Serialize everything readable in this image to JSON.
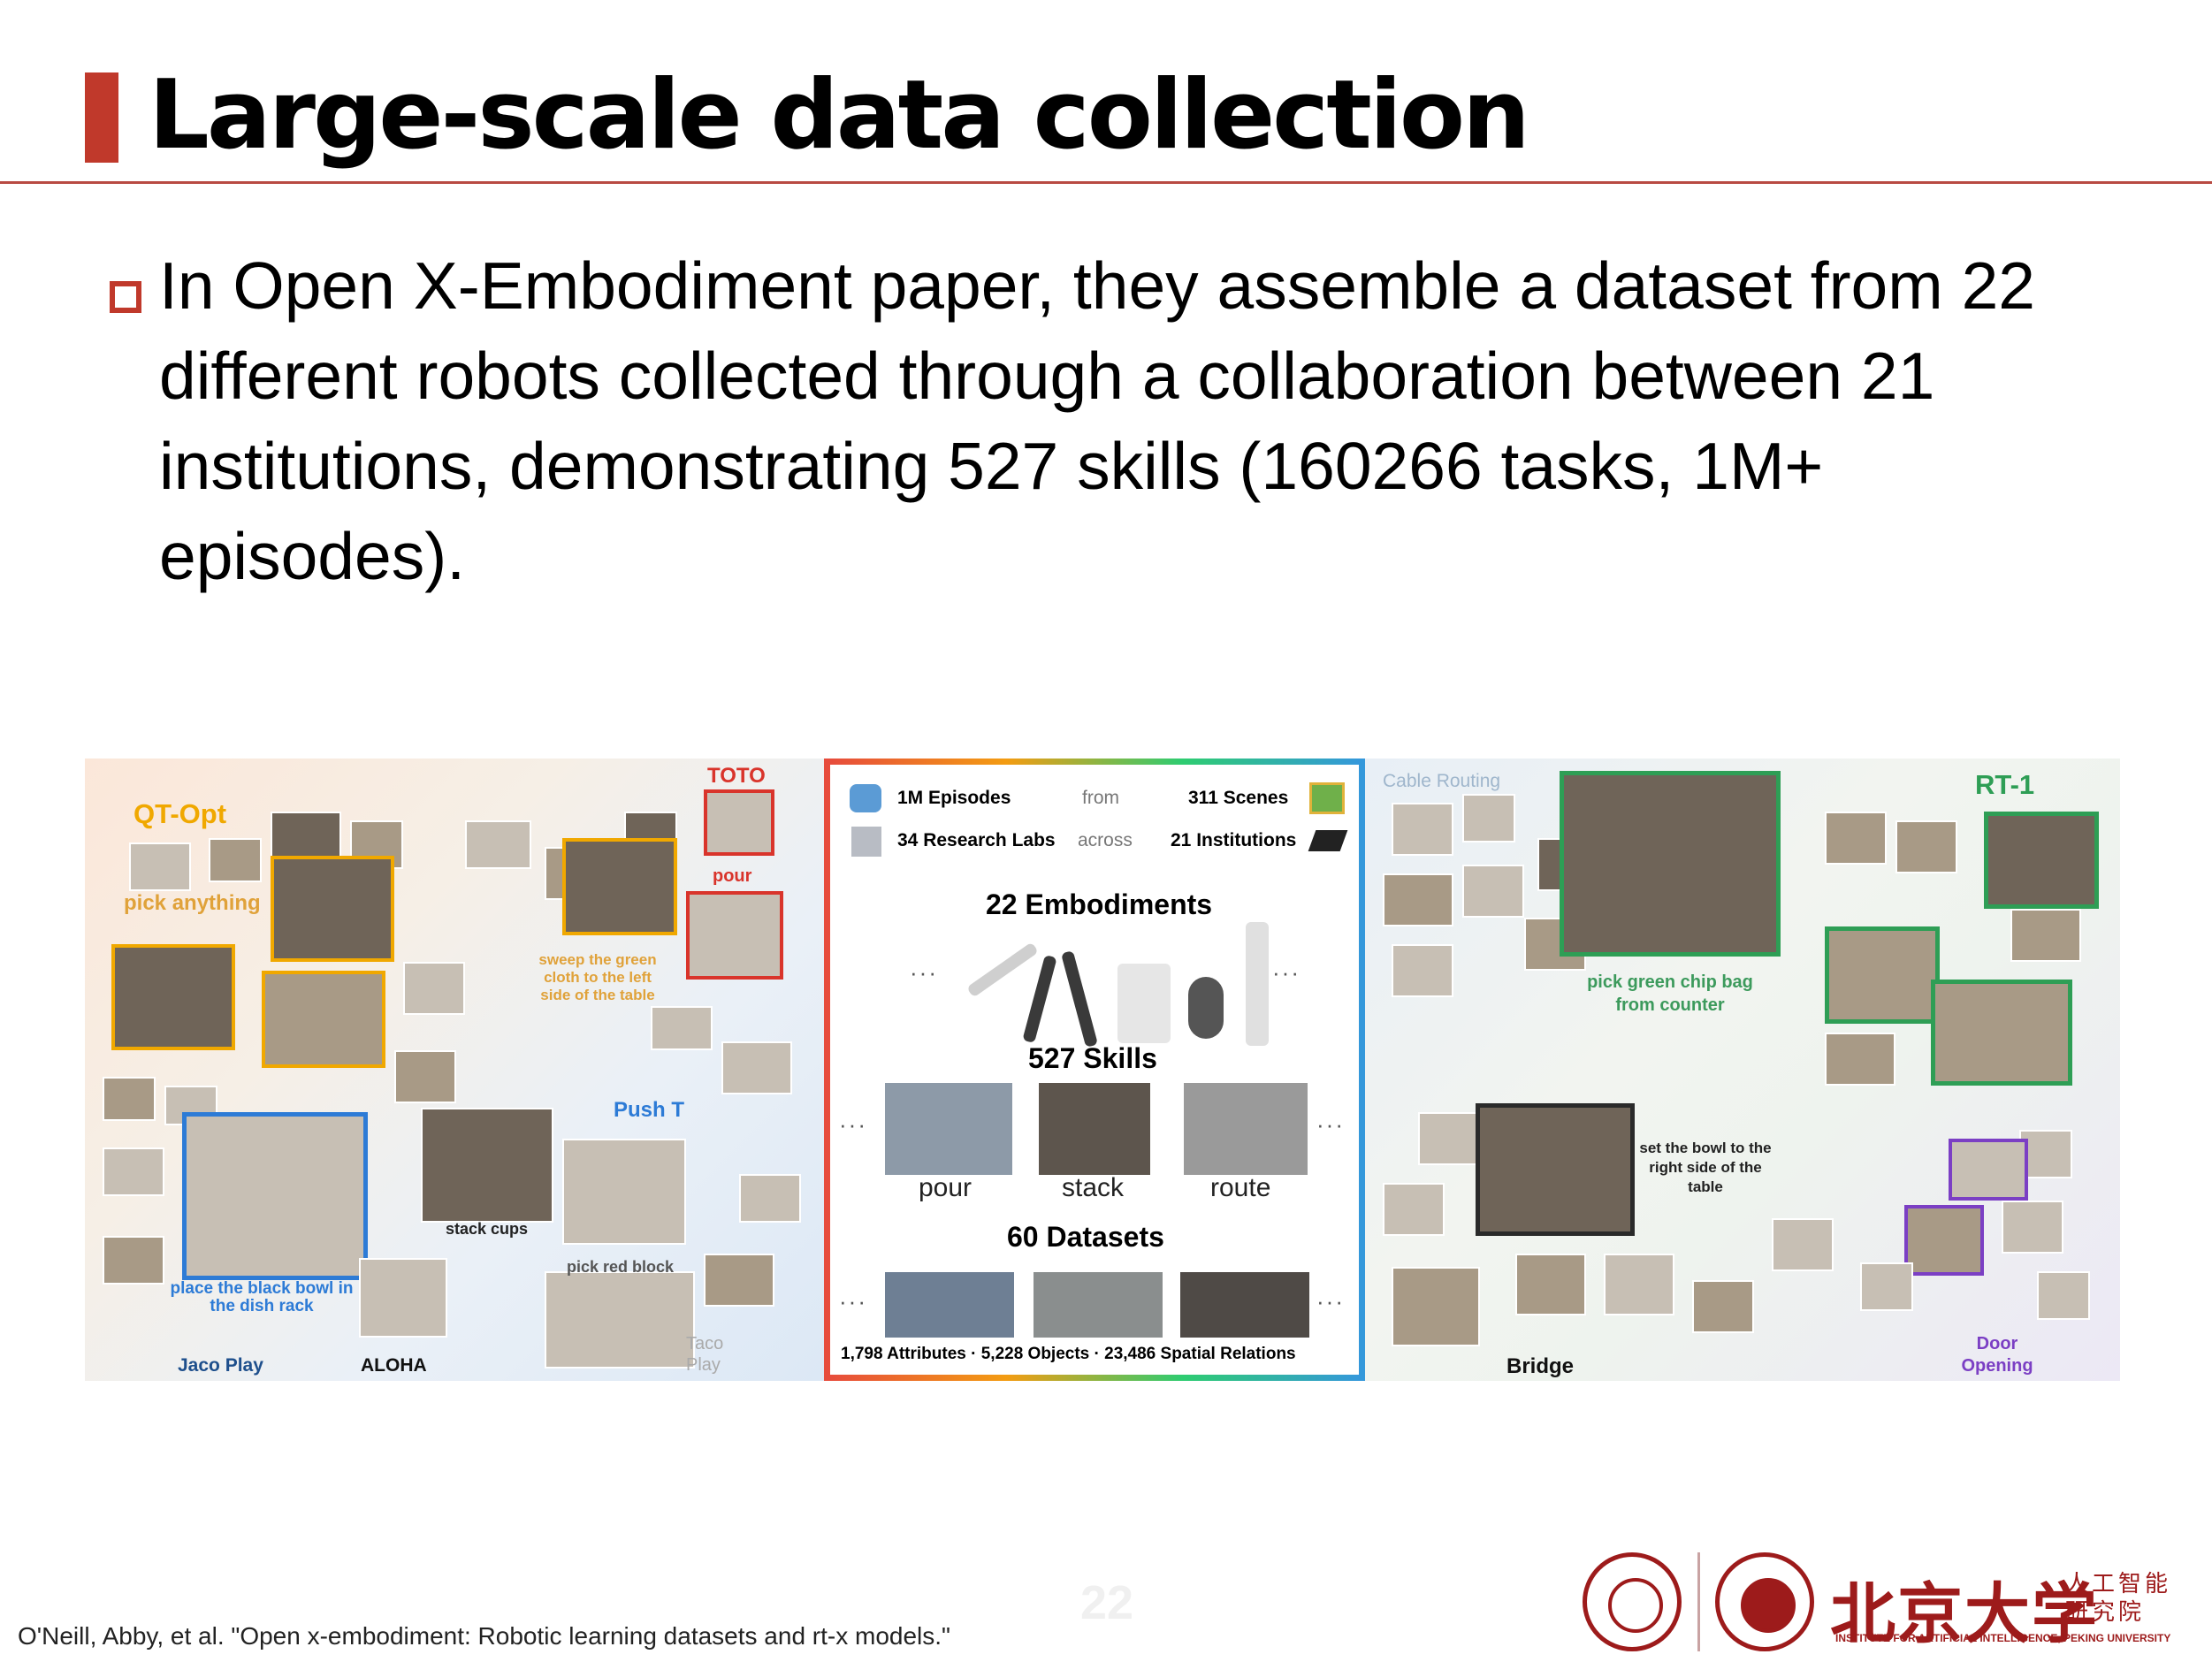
{
  "slide": {
    "title": "Large-scale data collection",
    "bullet": "In Open X-Embodiment paper, they assemble a dataset from 22 different robots collected through a collaboration between 21 institutions, demonstrating 527 skills (160266 tasks, 1M+ episodes).",
    "page_number": "22",
    "citation": "O'Neill, Abby, et al. \"Open x-embodiment: Robotic learning datasets and rt-x models.\""
  },
  "figure": {
    "left_labels": {
      "qt_opt": "QT-Opt",
      "pick_anything": "pick anything",
      "toto": "TOTO",
      "pour": "pour",
      "sweep": "sweep the green cloth to the left side of the table",
      "push_t": "Push T",
      "stack_cups": "stack cups",
      "pick_red_block": "pick red block",
      "place_black_bowl": "place the black bowl in the dish rack",
      "jaco_play": "Jaco Play",
      "aloha": "ALOHA",
      "taco_play": "Taco Play"
    },
    "center": {
      "episodes": "1M Episodes",
      "from": "from",
      "scenes": "311 Scenes",
      "labs": "34 Research Labs",
      "across": "across",
      "institutions": "21 Institutions",
      "embodiments": "22 Embodiments",
      "skills": "527 Skills",
      "skill_pour": "pour",
      "skill_stack": "stack",
      "skill_route": "route",
      "datasets": "60 Datasets",
      "dots": "···",
      "footer": "1,798 Attributes  ·  5,228 Objects  ·  23,486 Spatial Relations"
    },
    "right_labels": {
      "cable_routing": "Cable Routing",
      "rt1": "RT-1",
      "pick_chip": "pick green chip bag from counter",
      "set_bowl": "set the bowl to the right side of the table",
      "bridge": "Bridge",
      "door_opening": "Door Opening"
    }
  },
  "logos": {
    "pku_name": "北京大学",
    "institute_cn": "人工智能 研究院",
    "institute_en": "INSTITUTE FOR ARTIFICIAL INTELLIGENCE, PEKING UNIVERSITY"
  },
  "colors": {
    "accent_red": "#c0392b",
    "qt_opt": "#f0a800",
    "toto": "#d9342b",
    "push_t": "#2d7bd6",
    "rt1": "#2e9e55",
    "door": "#7b3fc4",
    "pku_red": "#9d1b1b"
  }
}
